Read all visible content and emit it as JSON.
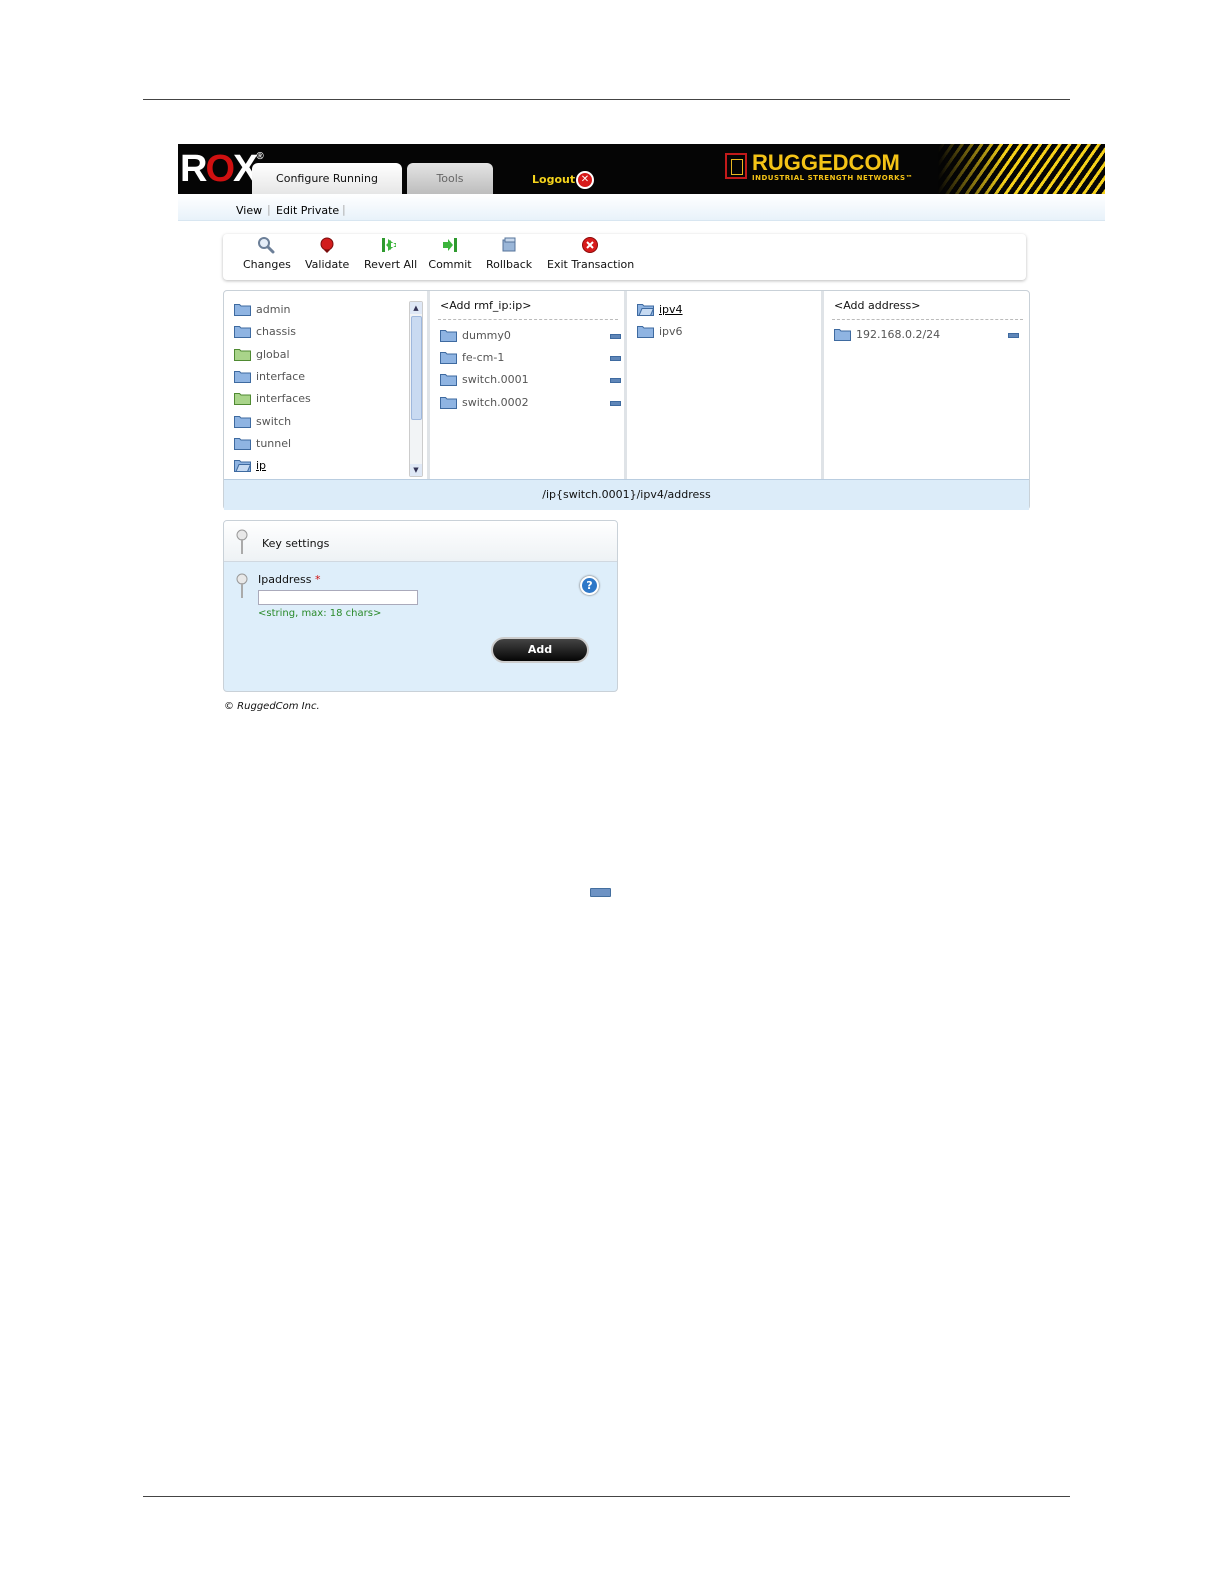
{
  "header": {
    "logo_text": "R",
    "logo_o": "O",
    "logo_x": "X",
    "logo_reg": "®",
    "tabs": [
      {
        "label": "Configure Running"
      },
      {
        "label": "Tools"
      }
    ],
    "logout_label": "Logout",
    "brand_name": "RUGGEDCOM",
    "brand_tagline": "INDUSTRIAL STRENGTH NETWORKS™"
  },
  "subnav": {
    "items": [
      {
        "label": "View"
      },
      {
        "label": "Edit Private"
      }
    ]
  },
  "toolbar": {
    "buttons": [
      {
        "label": "Changes",
        "icon": "magnifier-icon"
      },
      {
        "label": "Validate",
        "icon": "validate-icon"
      },
      {
        "label": "Revert All",
        "icon": "revert-icon"
      },
      {
        "label": "Commit",
        "icon": "commit-icon"
      },
      {
        "label": "Rollback",
        "icon": "rollback-icon"
      },
      {
        "label": "Exit Transaction",
        "icon": "exit-icon"
      }
    ]
  },
  "browser": {
    "col1": {
      "items": [
        {
          "label": "admin"
        },
        {
          "label": "chassis"
        },
        {
          "label": "global"
        },
        {
          "label": "interface"
        },
        {
          "label": "interfaces"
        },
        {
          "label": "switch"
        },
        {
          "label": "tunnel"
        },
        {
          "label": "ip"
        }
      ]
    },
    "col2": {
      "header": "<Add rmf_ip:ip>",
      "items": [
        {
          "label": "dummy0"
        },
        {
          "label": "fe-cm-1"
        },
        {
          "label": "switch.0001"
        },
        {
          "label": "switch.0002"
        }
      ]
    },
    "col3": {
      "items": [
        {
          "label": "ipv4"
        },
        {
          "label": "ipv6"
        }
      ]
    },
    "col4": {
      "header": "<Add address>",
      "items": [
        {
          "label": "192.168.0.2/24"
        }
      ]
    },
    "path": "/ip{switch.0001}/ipv4/address"
  },
  "key_settings": {
    "title": "Key settings",
    "field_label": "Ipaddress",
    "required_mark": "*",
    "field_value": "",
    "hint": "<string, max: 18 chars>",
    "add_label": "Add"
  },
  "footer": {
    "copyright": "© RuggedCom Inc."
  },
  "colors": {
    "header_bg": "#050505",
    "brand_yellow": "#f4c316",
    "accent_red": "#d01010",
    "panel_blue": "#deeefa",
    "hint_green": "#2a8a2a"
  }
}
